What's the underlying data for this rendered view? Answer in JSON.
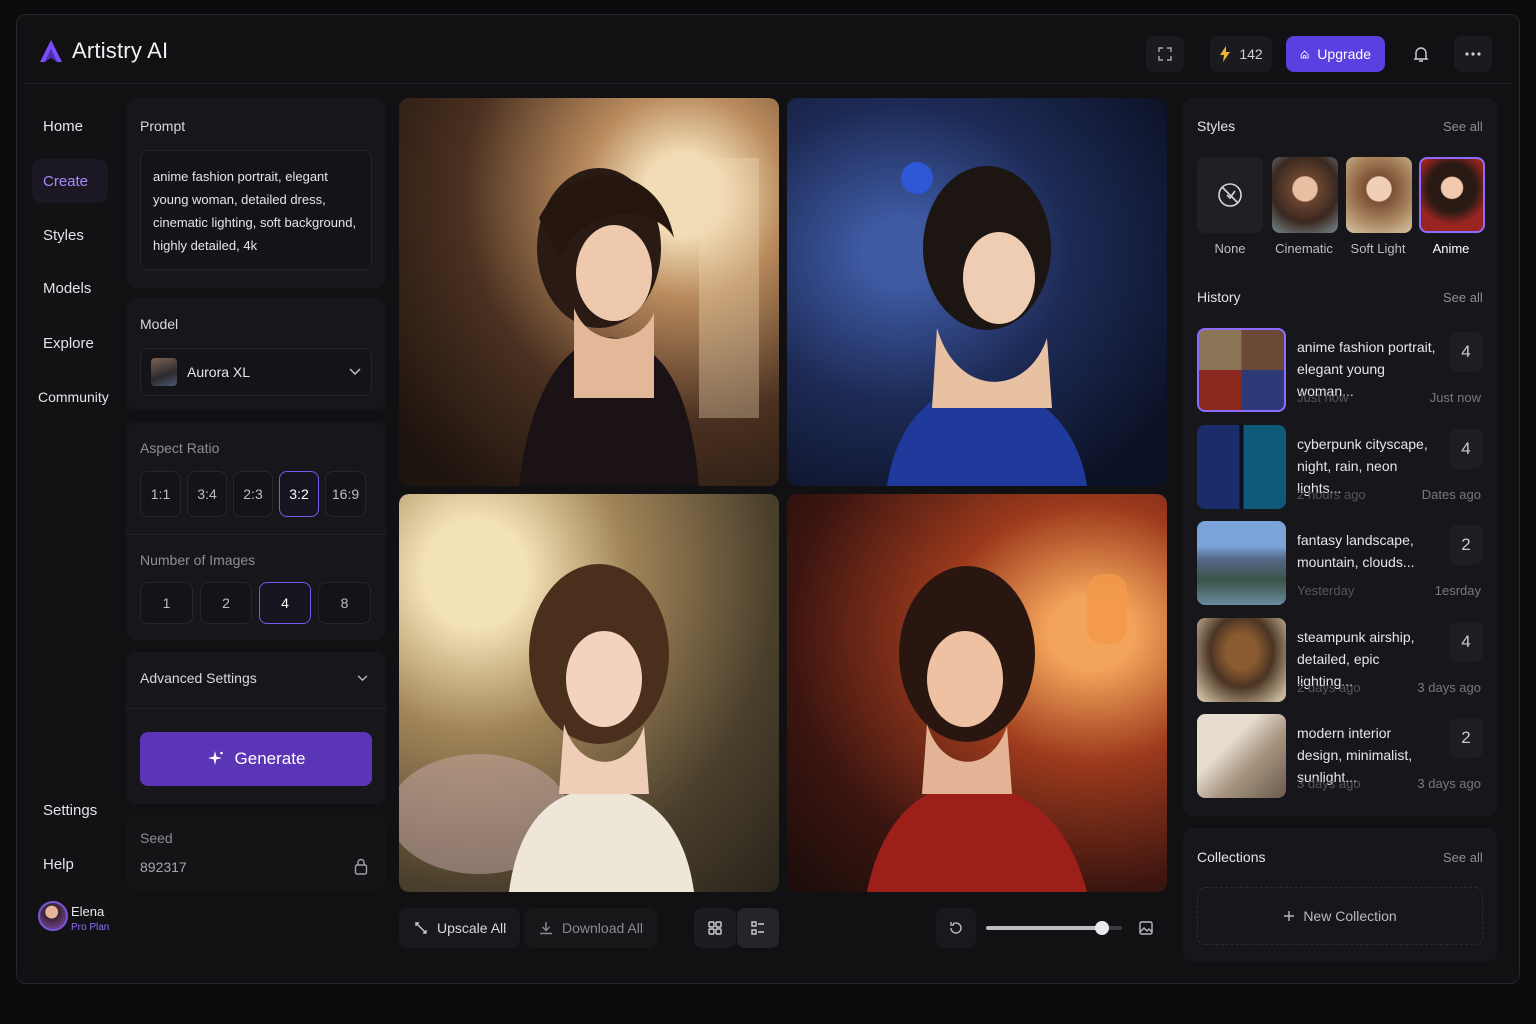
{
  "app": {
    "name": "Artistry AI",
    "brand_color": "#7c4dff"
  },
  "topbar": {
    "credits": "142",
    "upgrade_label": "Upgrade",
    "icons": [
      "fullscreen-icon",
      "lightning-icon",
      "upgrade-icon",
      "bell-icon",
      "more-icon"
    ]
  },
  "sidebar": {
    "items": [
      {
        "label": "Home"
      },
      {
        "label": "Create",
        "active": true
      },
      {
        "label": "Styles"
      },
      {
        "label": "Models"
      },
      {
        "label": "Explore"
      },
      {
        "label": "Community"
      }
    ],
    "bottom": [
      {
        "label": "Settings"
      },
      {
        "label": "Help"
      }
    ],
    "user": {
      "name": "Elena",
      "tier": "Pro Plan"
    }
  },
  "prompt": {
    "label": "Prompt",
    "text": "anime fashion portrait, elegant young woman, detailed dress, cinematic lighting, soft background, highly detailed, 4k"
  },
  "model": {
    "label": "Model",
    "selected": "Aurora XL"
  },
  "aspect_ratio": {
    "label": "Aspect Ratio",
    "options": [
      "1:1",
      "3:4",
      "2:3",
      "3:2",
      "16:9"
    ],
    "selected": "3:2"
  },
  "num_images": {
    "label": "Number of Images",
    "options": [
      "1",
      "2",
      "4",
      "8"
    ],
    "selected": "4"
  },
  "advanced": {
    "label": "Advanced Settings"
  },
  "generate_label": "Generate",
  "seed": {
    "label": "Seed",
    "value": "892317"
  },
  "gallery": {
    "images": [
      {
        "name": "generated-image-black-dress"
      },
      {
        "name": "generated-image-blue-dress"
      },
      {
        "name": "generated-image-white-dress"
      },
      {
        "name": "generated-image-red-dress"
      }
    ],
    "upscale_label": "Upscale All",
    "download_label": "Download All",
    "zoom_level": 0.85
  },
  "styles": {
    "title": "Styles",
    "see_all": "See all",
    "items": [
      {
        "label": "None"
      },
      {
        "label": "Cinematic"
      },
      {
        "label": "Soft Light"
      },
      {
        "label": "Anime",
        "selected": true
      }
    ]
  },
  "history": {
    "title": "History",
    "see_all": "See all",
    "items": [
      {
        "title": "anime fashion portrait, elegant young woman...",
        "count": "4",
        "time": "Just now",
        "time2": "Just now"
      },
      {
        "title": "cyberpunk cityscape, night, rain, neon lights...",
        "count": "4",
        "time": "2 hours ago",
        "time2": "Dates ago"
      },
      {
        "title": "fantasy landscape, mountain, clouds...",
        "count": "2",
        "time": "Yesterday",
        "time2": "1esrday"
      },
      {
        "title": "steampunk airship, detailed, epic lighting...",
        "count": "4",
        "time": "2 days ago",
        "time2": "3 days ago"
      },
      {
        "title": "modern interior design, minimalist, sunlight...",
        "count": "2",
        "time": "3 days ago",
        "time2": "3 days ago"
      }
    ]
  },
  "collections": {
    "title": "Collections",
    "see_all": "See all",
    "new_label": "New Collection"
  }
}
